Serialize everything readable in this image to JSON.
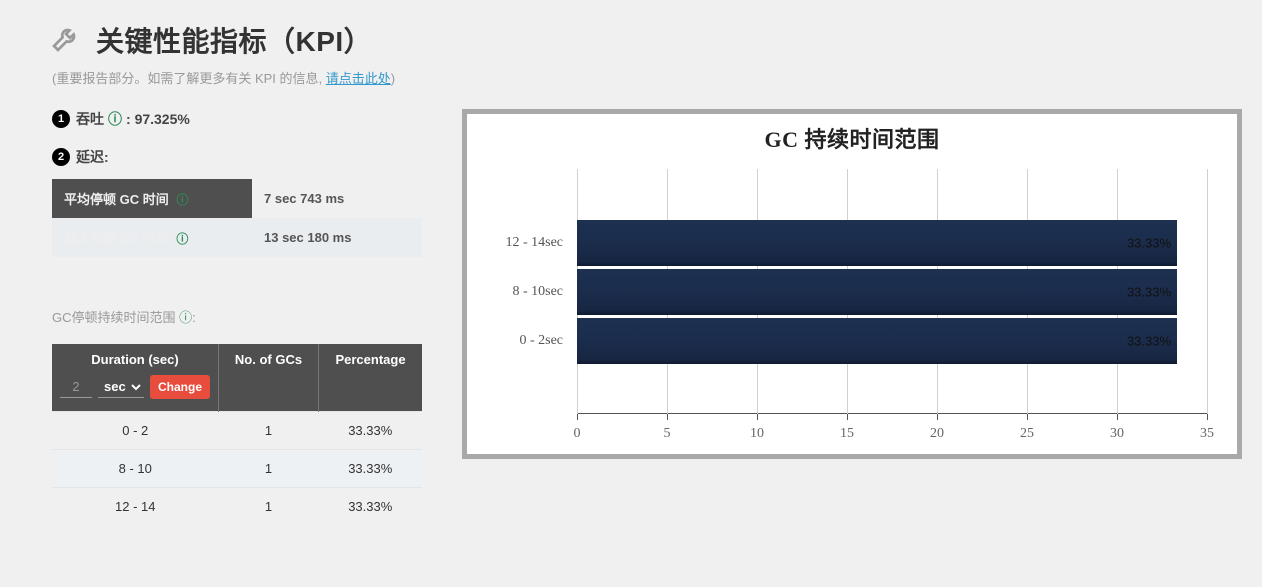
{
  "header": {
    "title": "关键性能指标（KPI）",
    "subtitle_prefix": "(重要报告部分。如需了解更多有关 KPI 的信息, ",
    "subtitle_link": "请点击此处",
    "subtitle_suffix": ")"
  },
  "kpi": {
    "throughput_label": "吞吐",
    "throughput_value": "97.325%",
    "latency_label": "延迟:",
    "metrics": [
      {
        "label": "平均停顿 GC 时间",
        "value": "7 sec 743 ms"
      },
      {
        "label": "最大停顿 GC 时间",
        "value": "13 sec 180 ms"
      }
    ]
  },
  "pause_range": {
    "section_label": "GC停顿持续时间范围",
    "headers": {
      "duration": "Duration (sec)",
      "count": "No. of GCs",
      "percentage": "Percentage"
    },
    "controls": {
      "input_value": "2",
      "unit": "sec",
      "change_label": "Change"
    },
    "rows": [
      {
        "range": "0 - 2",
        "count": "1",
        "pct": "33.33%"
      },
      {
        "range": "8 - 10",
        "count": "1",
        "pct": "33.33%"
      },
      {
        "range": "12 - 14",
        "count": "1",
        "pct": "33.33%"
      }
    ]
  },
  "chart_data": {
    "type": "bar",
    "orientation": "horizontal",
    "title": "GC 持续时间范围",
    "xlabel": "",
    "ylabel": "",
    "xlim": [
      0,
      35
    ],
    "xticks": [
      0,
      5,
      10,
      15,
      20,
      25,
      30,
      35
    ],
    "categories": [
      "12 - 14sec",
      "8 - 10sec",
      "0 - 2sec"
    ],
    "values": [
      33.33,
      33.33,
      33.33
    ],
    "value_labels": [
      "33.33%",
      "33.33%",
      "33.33%"
    ],
    "bar_color": "#1c2e4e"
  }
}
